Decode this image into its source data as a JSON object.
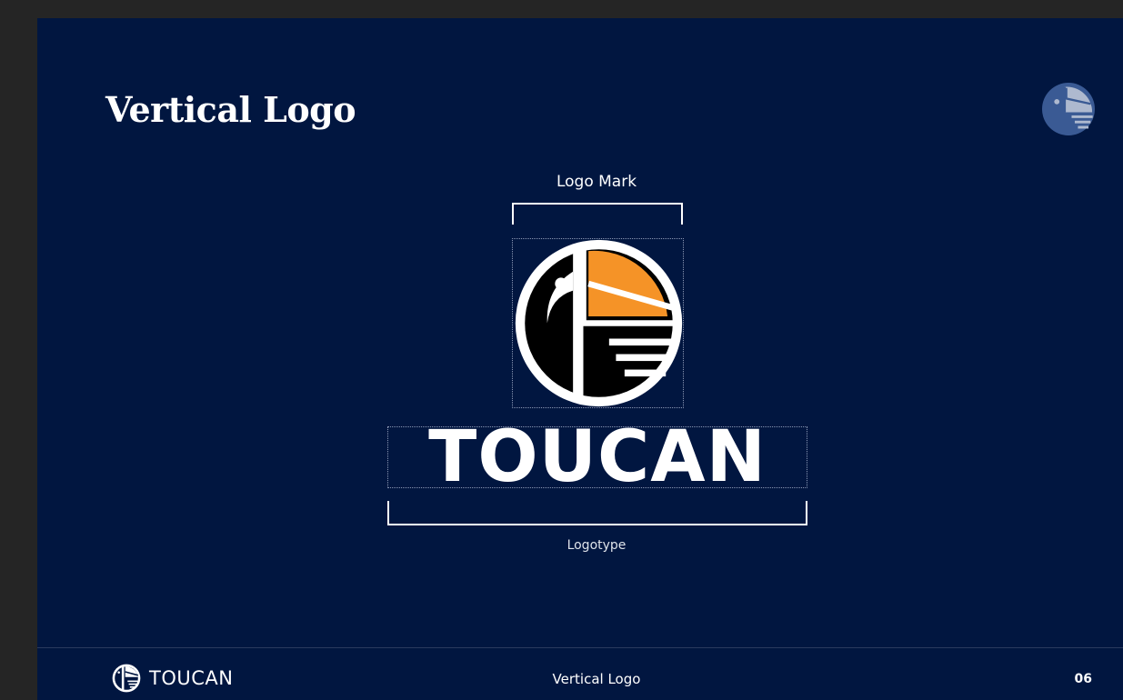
{
  "slide": {
    "title": "Vertical Logo",
    "logo_mark_label": "Logo Mark",
    "logotype_label": "Logotype",
    "logotype_text": "TOUCAN"
  },
  "footer": {
    "brand": "TOUCAN",
    "section": "Vertical Logo",
    "page_number": "06"
  },
  "colors": {
    "background": "#011640",
    "beak_orange": "#f59327",
    "white": "#ffffff",
    "black": "#000000",
    "corner_mark_blue": "#3a5a94"
  },
  "icons": {
    "corner": "toucan-logo-icon",
    "main": "toucan-logo-mark",
    "footer": "toucan-logo-icon"
  }
}
